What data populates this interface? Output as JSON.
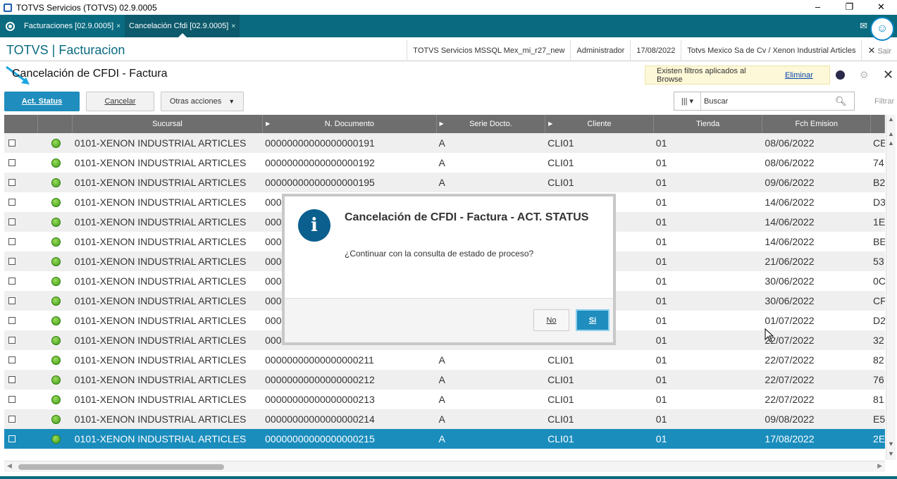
{
  "window": {
    "title": "TOTVS Servicios (TOTVS) 02.9.0005",
    "minimize": "–",
    "restore": "❐",
    "close": "✕"
  },
  "tabs": [
    {
      "label": "Facturaciones [02.9.0005]",
      "close": "×"
    },
    {
      "label": "Cancelación Cfdi [02.9.0005]",
      "close": "×"
    }
  ],
  "header": {
    "brand": "TOTVS | Facturacion",
    "environment": "TOTVS Servicios MSSQL Mex_mi_r27_new",
    "user": "Administrador",
    "date": "17/08/2022",
    "company": "Totvs Mexico Sa de Cv / Xenon Industrial Articles",
    "exit": "Sair",
    "exit_icon": "✕"
  },
  "page": {
    "title": "Cancelación de CFDI - Factura",
    "filter_notice": "Existen filtros aplicados al Browse",
    "filter_remove": "Eliminar"
  },
  "toolbar": {
    "act_status": "Act. Status",
    "cancelar": "Cancelar",
    "otras_acciones": "Otras acciones",
    "search_placeholder": "Buscar",
    "filtrar": "Filtrar"
  },
  "grid": {
    "columns": [
      "",
      "",
      "Sucursal",
      "N. Documento",
      "Serie Docto.",
      "Cliente",
      "Tienda",
      "Fch Emision"
    ],
    "rows": [
      {
        "sucursal": "0101-XENON INDUSTRIAL ARTICLES",
        "documento": "00000000000000000191",
        "serie": "A",
        "cliente": "CLI01",
        "tienda": "01",
        "fecha": "08/06/2022",
        "extra": "CE"
      },
      {
        "sucursal": "0101-XENON INDUSTRIAL ARTICLES",
        "documento": "00000000000000000192",
        "serie": "A",
        "cliente": "CLI01",
        "tienda": "01",
        "fecha": "08/06/2022",
        "extra": "74"
      },
      {
        "sucursal": "0101-XENON INDUSTRIAL ARTICLES",
        "documento": "00000000000000000195",
        "serie": "A",
        "cliente": "CLI01",
        "tienda": "01",
        "fecha": "09/06/2022",
        "extra": "B2"
      },
      {
        "sucursal": "0101-XENON INDUSTRIAL ARTICLES",
        "documento": "000",
        "serie": "",
        "cliente": "",
        "tienda": "01",
        "fecha": "14/06/2022",
        "extra": "D3"
      },
      {
        "sucursal": "0101-XENON INDUSTRIAL ARTICLES",
        "documento": "000",
        "serie": "",
        "cliente": "",
        "tienda": "01",
        "fecha": "14/06/2022",
        "extra": "1E"
      },
      {
        "sucursal": "0101-XENON INDUSTRIAL ARTICLES",
        "documento": "000",
        "serie": "",
        "cliente": "",
        "tienda": "01",
        "fecha": "14/06/2022",
        "extra": "BE"
      },
      {
        "sucursal": "0101-XENON INDUSTRIAL ARTICLES",
        "documento": "000",
        "serie": "",
        "cliente": "",
        "tienda": "01",
        "fecha": "21/06/2022",
        "extra": "53"
      },
      {
        "sucursal": "0101-XENON INDUSTRIAL ARTICLES",
        "documento": "000",
        "serie": "",
        "cliente": "",
        "tienda": "01",
        "fecha": "30/06/2022",
        "extra": "0C"
      },
      {
        "sucursal": "0101-XENON INDUSTRIAL ARTICLES",
        "documento": "000",
        "serie": "",
        "cliente": "",
        "tienda": "01",
        "fecha": "30/06/2022",
        "extra": "CF"
      },
      {
        "sucursal": "0101-XENON INDUSTRIAL ARTICLES",
        "documento": "000",
        "serie": "",
        "cliente": "",
        "tienda": "01",
        "fecha": "01/07/2022",
        "extra": "D2"
      },
      {
        "sucursal": "0101-XENON INDUSTRIAL ARTICLES",
        "documento": "000",
        "serie": "",
        "cliente": "",
        "tienda": "01",
        "fecha": "22/07/2022",
        "extra": "32"
      },
      {
        "sucursal": "0101-XENON INDUSTRIAL ARTICLES",
        "documento": "00000000000000000211",
        "serie": "A",
        "cliente": "CLI01",
        "tienda": "01",
        "fecha": "22/07/2022",
        "extra": "82"
      },
      {
        "sucursal": "0101-XENON INDUSTRIAL ARTICLES",
        "documento": "00000000000000000212",
        "serie": "A",
        "cliente": "CLI01",
        "tienda": "01",
        "fecha": "22/07/2022",
        "extra": "76"
      },
      {
        "sucursal": "0101-XENON INDUSTRIAL ARTICLES",
        "documento": "00000000000000000213",
        "serie": "A",
        "cliente": "CLI01",
        "tienda": "01",
        "fecha": "22/07/2022",
        "extra": "81"
      },
      {
        "sucursal": "0101-XENON INDUSTRIAL ARTICLES",
        "documento": "00000000000000000214",
        "serie": "A",
        "cliente": "CLI01",
        "tienda": "01",
        "fecha": "09/08/2022",
        "extra": "E5"
      },
      {
        "sucursal": "0101-XENON INDUSTRIAL ARTICLES",
        "documento": "00000000000000000215",
        "serie": "A",
        "cliente": "CLI01",
        "tienda": "01",
        "fecha": "17/08/2022",
        "extra": "2E",
        "selected": true
      }
    ]
  },
  "dialog": {
    "icon": "i",
    "title": "Cancelación de CFDI - Factura - ACT. STATUS",
    "message": "¿Continuar con la consulta de estado de proceso?",
    "no": "No",
    "si": "Si"
  },
  "colors": {
    "accent": "#1f8dbd",
    "tabbar": "#0a6b80",
    "status_green": "#4caf20",
    "header_gray": "#6e6e6e"
  }
}
